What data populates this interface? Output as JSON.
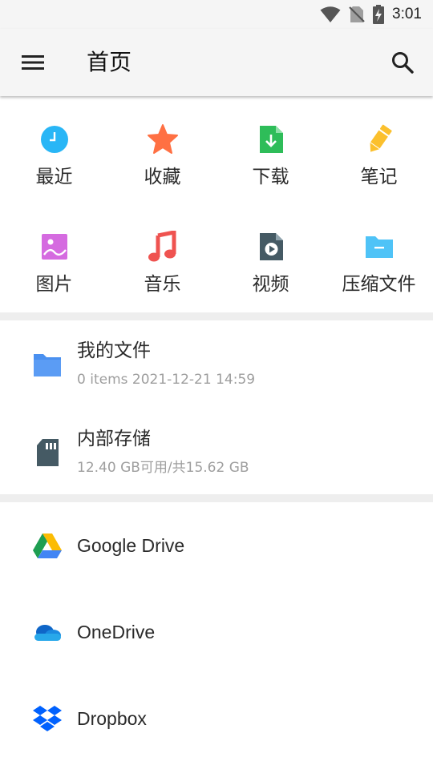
{
  "status_bar": {
    "time": "3:01",
    "icons": [
      "wifi-icon",
      "no-sim-icon",
      "battery-charging-icon"
    ]
  },
  "app_bar": {
    "title": "首页",
    "menu_icon": "menu-icon",
    "search_icon": "search-icon"
  },
  "categories": [
    {
      "label": "最近",
      "icon": "clock-icon",
      "color": "#29b6f6"
    },
    {
      "label": "收藏",
      "icon": "star-icon",
      "color": "#ff7043"
    },
    {
      "label": "下载",
      "icon": "download-icon",
      "color": "#2ebd59"
    },
    {
      "label": "笔记",
      "icon": "pencil-icon",
      "color": "#fbc02d"
    },
    {
      "label": "图片",
      "icon": "image-icon",
      "color": "#d56be0"
    },
    {
      "label": "音乐",
      "icon": "music-icon",
      "color": "#ef5350"
    },
    {
      "label": "视频",
      "icon": "video-icon",
      "color": "#455a64"
    },
    {
      "label": "压缩文件",
      "icon": "archive-icon",
      "color": "#4fc3f7"
    }
  ],
  "storage": [
    {
      "title": "我的文件",
      "subtitle": "0 items 2021-12-21 14:59",
      "icon": "folder-icon",
      "color": "#4a90f0"
    },
    {
      "title": "内部存储",
      "subtitle": "12.40 GB可用/共15.62 GB",
      "icon": "sd-card-icon",
      "color": "#455a64"
    }
  ],
  "cloud": [
    {
      "label": "Google Drive",
      "icon": "google-drive-icon"
    },
    {
      "label": "OneDrive",
      "icon": "onedrive-icon"
    },
    {
      "label": "Dropbox",
      "icon": "dropbox-icon"
    }
  ]
}
